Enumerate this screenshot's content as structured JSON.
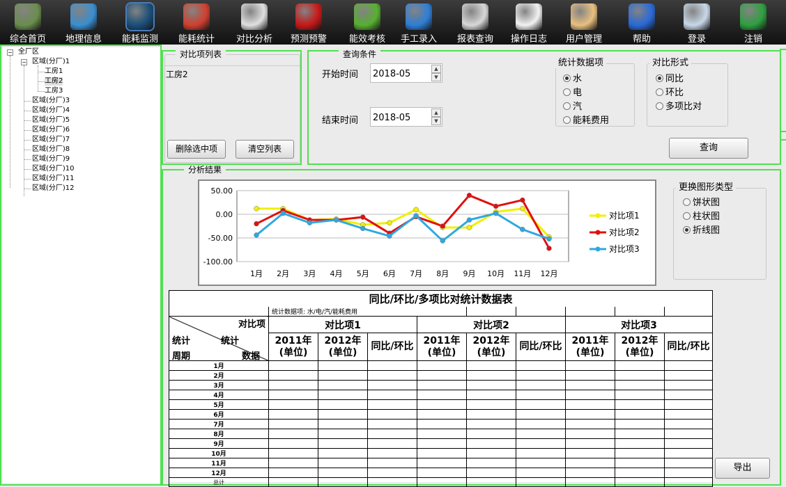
{
  "toolbar": [
    {
      "label": "综合首页",
      "icon": "home-icon",
      "color": "#6b8e4e"
    },
    {
      "label": "地理信息",
      "icon": "globe-icon",
      "color": "#3a8fd0"
    },
    {
      "label": "能耗监测",
      "icon": "monitor-wave-icon",
      "color": "#1a4f7a"
    },
    {
      "label": "能耗统计",
      "icon": "percent-chart-icon",
      "color": "#d04030"
    },
    {
      "label": "对比分析",
      "icon": "compare-chart-icon",
      "color": "#e0e0e0"
    },
    {
      "label": "预测预警",
      "icon": "alarm-light-icon",
      "color": "#c81818"
    },
    {
      "label": "能效考核",
      "icon": "atom-icon",
      "color": "#58b030"
    },
    {
      "label": "手工录入",
      "icon": "keyboard-icon",
      "color": "#2e7fd8"
    },
    {
      "label": "报表查询",
      "icon": "report-icon",
      "color": "#d8d8d8"
    },
    {
      "label": "操作日志",
      "icon": "log-book-icon",
      "color": "#f2f2f2"
    },
    {
      "label": "用户管理",
      "icon": "users-icon",
      "color": "#e8c080"
    },
    {
      "label": "帮助",
      "icon": "help-icon",
      "color": "#2a6ad8"
    },
    {
      "label": "登录",
      "icon": "login-lock-icon",
      "color": "#c8d8e8"
    },
    {
      "label": "注销",
      "icon": "exit-icon",
      "color": "#2ea040"
    }
  ],
  "tree": {
    "root": "全厂区",
    "zone1": "区域(分厂)1",
    "rooms": [
      "工房1",
      "工房2",
      "工房3"
    ],
    "zones": [
      "区域(分厂)3",
      "区域(分厂)4",
      "区域(分厂)5",
      "区域(分厂)6",
      "区域(分厂)7",
      "区域(分厂)8",
      "区域(分厂)9",
      "区域(分厂)10",
      "区域(分厂)11",
      "区域(分厂)12"
    ]
  },
  "compare_list": {
    "title": "对比项列表",
    "items": [
      "工房2"
    ],
    "delete_btn": "删除选中项",
    "clear_btn": "清空列表"
  },
  "query": {
    "title": "查询条件",
    "start_label": "开始时间",
    "start_value": "2018-05",
    "end_label": "结束时间",
    "end_value": "2018-05",
    "stat_title": "统计数据项",
    "stat_options": [
      "水",
      "电",
      "汽",
      "能耗费用"
    ],
    "stat_selected": 0,
    "form_title": "对比形式",
    "form_options": [
      "同比",
      "环比",
      "多项比对"
    ],
    "form_selected": 0,
    "query_btn": "查询"
  },
  "analysis": {
    "title": "分析结果",
    "chart_type_title": "更换图形类型",
    "chart_types": [
      "饼状图",
      "柱状图",
      "折线图"
    ],
    "chart_type_selected": 2,
    "export_btn": "导出"
  },
  "chart_data": {
    "type": "line",
    "categories": [
      "1月",
      "2月",
      "3月",
      "4月",
      "5月",
      "6月",
      "7月",
      "8月",
      "9月",
      "10月",
      "11月",
      "12月"
    ],
    "yticks": [
      "50.00",
      "0.00",
      "-50.00",
      "-100.00"
    ],
    "ylim": [
      -100,
      50
    ],
    "series": [
      {
        "name": "对比项1",
        "color": "#f0f000",
        "values": [
          12,
          12,
          -12,
          -10,
          -22,
          -18,
          10,
          -28,
          -28,
          5,
          12,
          -48
        ]
      },
      {
        "name": "对比项2",
        "color": "#e01010",
        "values": [
          -20,
          8,
          -12,
          -12,
          -6,
          -40,
          -5,
          -25,
          40,
          17,
          30,
          -72
        ]
      },
      {
        "name": "对比项3",
        "color": "#30a8e0",
        "values": [
          -44,
          2,
          -18,
          -12,
          -30,
          -46,
          -3,
          -56,
          -12,
          2,
          -32,
          -52
        ]
      }
    ],
    "legend": "right"
  },
  "table": {
    "title": "同比/环比/多项比对统计数据表",
    "stat_note": "统计数据项:  水/电/汽/能耗费用",
    "corner_top": "对比项",
    "corner_mid": "统计",
    "corner_mid2": "统计",
    "corner_left": "周期",
    "corner_right": "数据",
    "groups": [
      "对比项1",
      "对比项2",
      "对比项3"
    ],
    "sub": [
      "2011年(单位)",
      "2012年(单位)",
      "同比/环比"
    ],
    "months": [
      "1月",
      "2月",
      "3月",
      "4月",
      "5月",
      "6月",
      "7月",
      "8月",
      "9月",
      "10月",
      "11月",
      "12月"
    ],
    "total": "总计"
  }
}
